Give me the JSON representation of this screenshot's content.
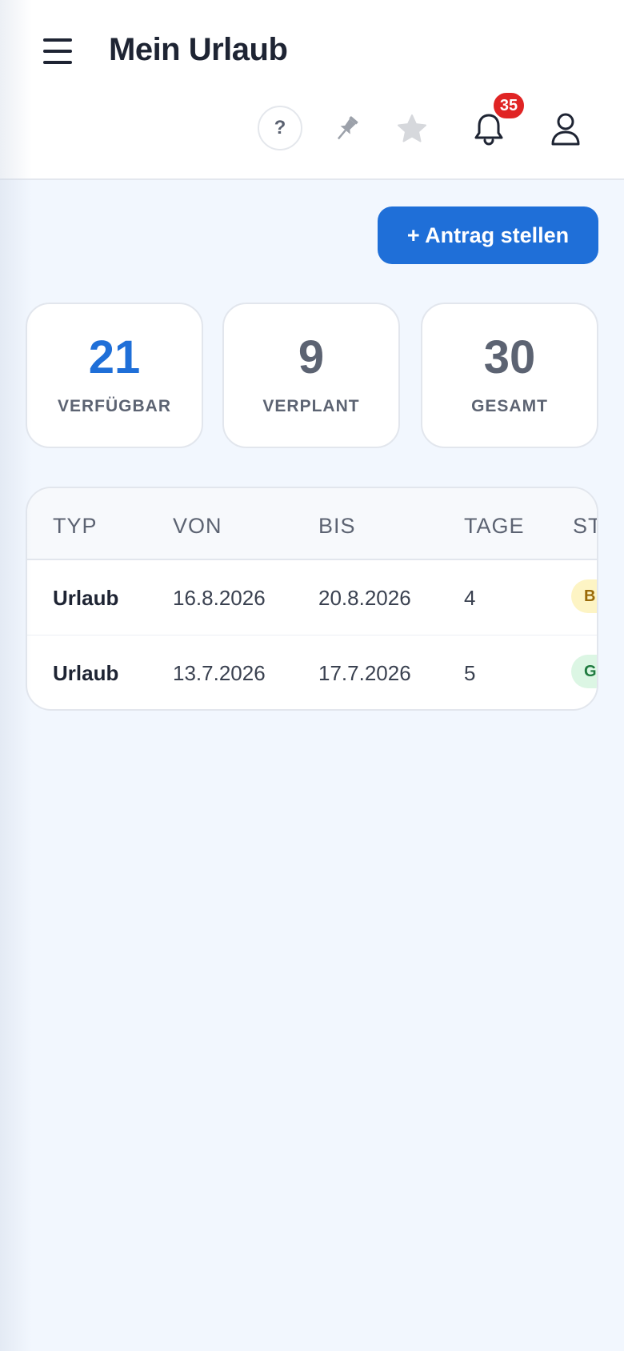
{
  "header": {
    "title": "Mein Urlaub",
    "help_label": "?",
    "notification_count": "35"
  },
  "actions": {
    "new_request_label": "+ Antrag stellen"
  },
  "stats": [
    {
      "value": "21",
      "label": "VERFÜGBAR"
    },
    {
      "value": "9",
      "label": "VERPLANT"
    },
    {
      "value": "30",
      "label": "GESAMT"
    }
  ],
  "table": {
    "columns": [
      "TYP",
      "VON",
      "BIS",
      "TAGE",
      "ST"
    ],
    "rows": [
      {
        "typ": "Urlaub",
        "von": "16.8.2026",
        "bis": "20.8.2026",
        "tage": "4",
        "status": "B"
      },
      {
        "typ": "Urlaub",
        "von": "13.7.2026",
        "bis": "17.7.2026",
        "tage": "5",
        "status": "G"
      }
    ]
  },
  "colors": {
    "accent": "#1f6fd8",
    "badge": "#e02424",
    "status_yellow": "#fdf4c4",
    "status_green": "#dcf6e4"
  },
  "icons": [
    "menu-icon",
    "pin-icon",
    "star-icon",
    "bell-icon",
    "user-icon"
  ]
}
